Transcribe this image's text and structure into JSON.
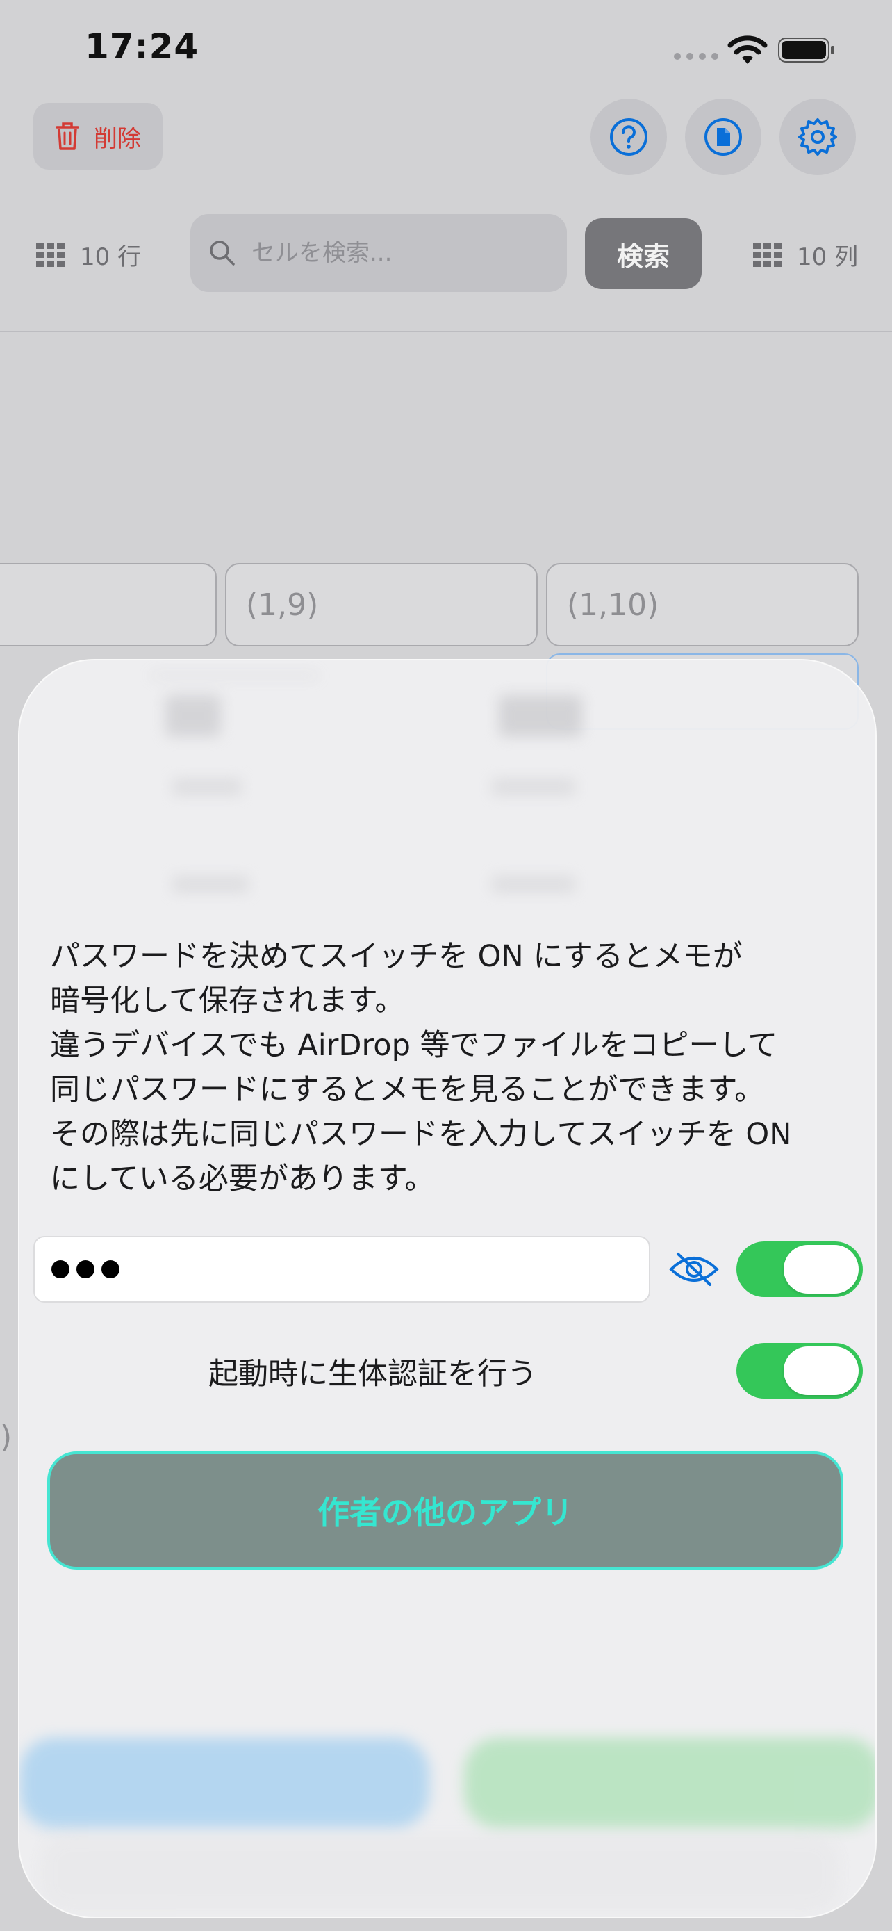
{
  "status_bar": {
    "time": "17:24"
  },
  "toolbar": {
    "delete_label": "削除",
    "help_icon": "question-circle-icon",
    "document_icon": "document-icon",
    "settings_icon": "gear-icon"
  },
  "search_row": {
    "rows_label": "10 行",
    "search_placeholder": "セルを検索...",
    "search_button": "検索",
    "cols_label": "10 列"
  },
  "grid": {
    "visible_headers": [
      "(1,9)",
      "(1,10)"
    ],
    "partial_edge_text": ")"
  },
  "sheet": {
    "description_lines": [
      "パスワードを決めてスイッチを ON にするとメモが",
      "暗号化して保存されます。",
      "違うデバイスでも AirDrop 等でファイルをコピーして",
      "同じパスワードにするとメモを見ることができます。",
      "その際は先に同じパスワードを入力してスイッチを ON",
      "にしている必要があります。"
    ],
    "password_value": "•••",
    "password_toggle_on": true,
    "biometric_label": "起動時に生体認証を行う",
    "biometric_toggle_on": true,
    "other_apps_button": "作者の他のアプリ"
  },
  "colors": {
    "accent_blue": "#0a6fd8",
    "delete_red": "#d33a34",
    "toggle_green": "#34c759",
    "apps_button_text": "#35e6d0",
    "apps_button_border": "#46e5d2"
  }
}
